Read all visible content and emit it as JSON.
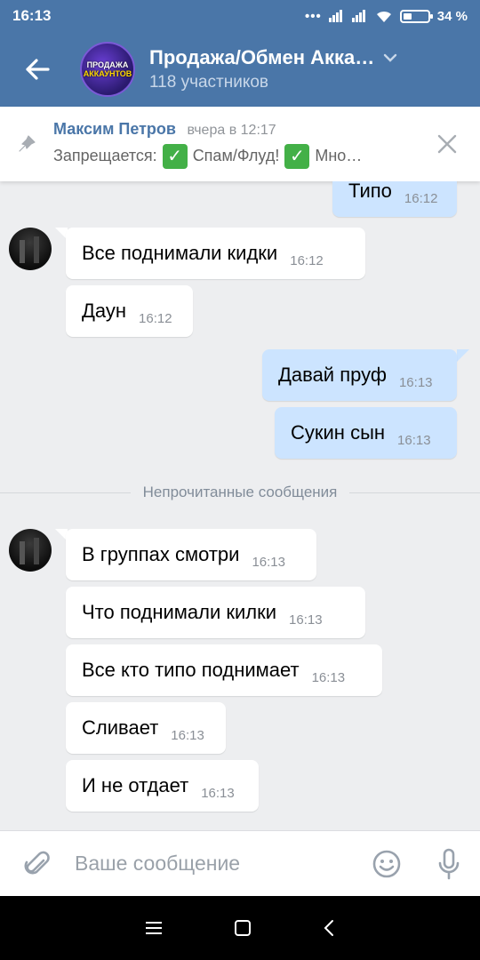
{
  "status_bar": {
    "time": "16:13",
    "battery": "34 %",
    "battery_level": 0.34
  },
  "header": {
    "title": "Продажа/Обмен Акка…",
    "subtitle": "118 участников",
    "avatar_text": [
      "ПРОДАЖА",
      "АККАУНТОВ"
    ],
    "accent_color": "#4a76a8"
  },
  "pinned": {
    "author": "Максим Петров",
    "time": "вчера в 12:17",
    "text_prefix": "Запрещается:",
    "item1": "Спам/Флуд!",
    "item2": "Мно…"
  },
  "messages": [
    {
      "text": "Типо",
      "time": "16:12",
      "direction": "out"
    },
    {
      "text": "Все поднимали кидки",
      "time": "16:12",
      "direction": "in"
    },
    {
      "text": "Даун",
      "time": "16:12",
      "direction": "in"
    },
    {
      "text": "Давай пруф",
      "time": "16:13",
      "direction": "out"
    },
    {
      "text": "Сукин сын",
      "time": "16:13",
      "direction": "out"
    },
    {
      "text": "В группах смотри",
      "time": "16:13",
      "direction": "in"
    },
    {
      "text": "Что поднимали килки",
      "time": "16:13",
      "direction": "in"
    },
    {
      "text": "Все кто типо поднимает",
      "time": "16:13",
      "direction": "in"
    },
    {
      "text": "Сливает",
      "time": "16:13",
      "direction": "in"
    },
    {
      "text": "И не отдает",
      "time": "16:13",
      "direction": "in"
    }
  ],
  "unread_divider": "Непрочитанные сообщения",
  "composer": {
    "placeholder": "Ваше сообщение"
  },
  "icons": [
    "back-arrow-icon",
    "chevron-down-icon",
    "pin-icon",
    "close-icon",
    "paperclip-icon",
    "emoji-icon",
    "microphone-icon",
    "menu-icon",
    "home-square-icon",
    "nav-back-icon"
  ]
}
